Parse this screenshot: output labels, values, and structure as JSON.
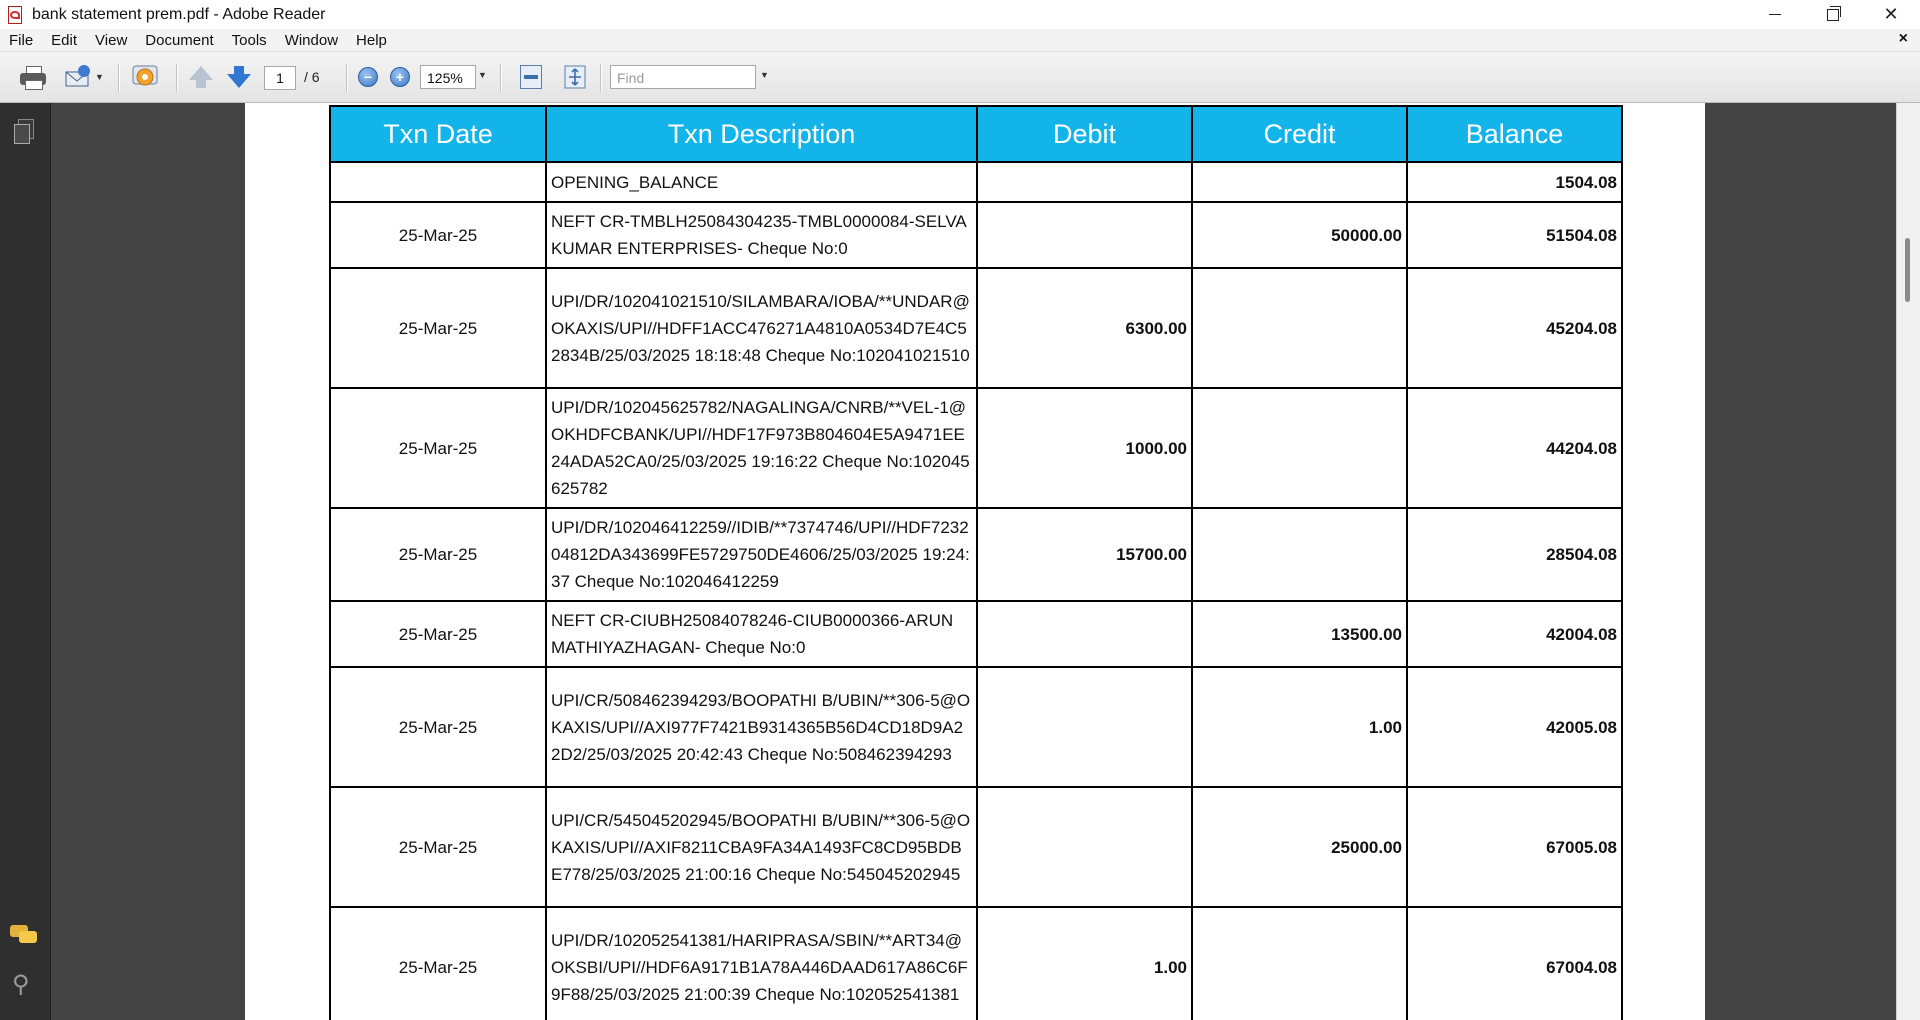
{
  "window": {
    "title": "bank statement prem.pdf - Adobe Reader",
    "controls": {
      "minimize": "minimize",
      "restore": "restore",
      "close": "✕"
    }
  },
  "menu": [
    "File",
    "Edit",
    "View",
    "Document",
    "Tools",
    "Window",
    "Help"
  ],
  "menu_close": "×",
  "toolbar": {
    "page_current": "1",
    "page_total": "/ 6",
    "zoom": "125%",
    "find_placeholder": "Find",
    "icons": [
      "print-icon",
      "email-icon",
      "collaborate-icon",
      "previous-page-icon",
      "next-page-icon",
      "zoom-out-icon",
      "zoom-in-icon",
      "fit-width-icon",
      "fit-page-icon"
    ]
  },
  "statement": {
    "headers": [
      "Txn Date",
      "Txn Description",
      "Debit",
      "Credit",
      "Balance"
    ],
    "rows": [
      {
        "date": "",
        "desc": "OPENING_BALANCE",
        "debit": "",
        "credit": "",
        "balance": "1504.08"
      },
      {
        "date": "25-Mar-25",
        "desc": "NEFT CR-TMBLH25084304235-TMBL0000084-SELVAKUMAR ENTERPRISES- Cheque No:0",
        "debit": "",
        "credit": "50000.00",
        "balance": "51504.08"
      },
      {
        "date": "25-Mar-25",
        "desc": "UPI/DR/102041021510/SILAMBARA/IOBA/**UNDAR@OKAXIS/UPI//HDFF1ACC476271A4810A0534D7E4C52834B/25/03/2025 18:18:48 Cheque No:102041021510",
        "debit": "6300.00",
        "credit": "",
        "balance": "45204.08"
      },
      {
        "date": "25-Mar-25",
        "desc": "UPI/DR/102045625782/NAGALINGA/CNRB/**VEL-1@OKHDFCBANK/UPI//HDF17F973B804604E5A9471EE24ADA52CA0/25/03/2025 19:16:22 Cheque No:102045625782",
        "debit": "1000.00",
        "credit": "",
        "balance": "44204.08"
      },
      {
        "date": "25-Mar-25",
        "desc": "UPI/DR/102046412259//IDIB/**7374746/UPI//HDF723204812DA343699FE5729750DE4606/25/03/2025 19:24:37 Cheque No:102046412259",
        "debit": "15700.00",
        "credit": "",
        "balance": "28504.08"
      },
      {
        "date": "25-Mar-25",
        "desc": "NEFT CR-CIUBH25084078246-CIUB0000366-ARUN MATHIYAZHAGAN- Cheque No:0",
        "debit": "",
        "credit": "13500.00",
        "balance": "42004.08"
      },
      {
        "date": "25-Mar-25",
        "desc": "UPI/CR/508462394293/BOOPATHI B/UBIN/**306-5@OKAXIS/UPI//AXI977F7421B9314365B56D4CD18D9A22D2/25/03/2025 20:42:43 Cheque No:508462394293",
        "debit": "",
        "credit": "1.00",
        "balance": "42005.08"
      },
      {
        "date": "25-Mar-25",
        "desc": "UPI/CR/545045202945/BOOPATHI B/UBIN/**306-5@OKAXIS/UPI//AXIF8211CBA9FA34A1493FC8CD95BDBE778/25/03/2025 21:00:16 Cheque No:545045202945",
        "debit": "",
        "credit": "25000.00",
        "balance": "67005.08"
      },
      {
        "date": "25-Mar-25",
        "desc": "UPI/DR/102052541381/HARIPRASA/SBIN/**ART34@OKSBI/UPI//HDF6A9171B1A78A446DAAD617A86C6F9F88/25/03/2025 21:00:39 Cheque No:102052541381",
        "debit": "1.00",
        "credit": "",
        "balance": "67004.08"
      }
    ]
  },
  "colors": {
    "header_bg": "#12b4ea",
    "debit": "#d2691e",
    "credit": "#2e9e3a",
    "balance": "#1c3fd1"
  }
}
